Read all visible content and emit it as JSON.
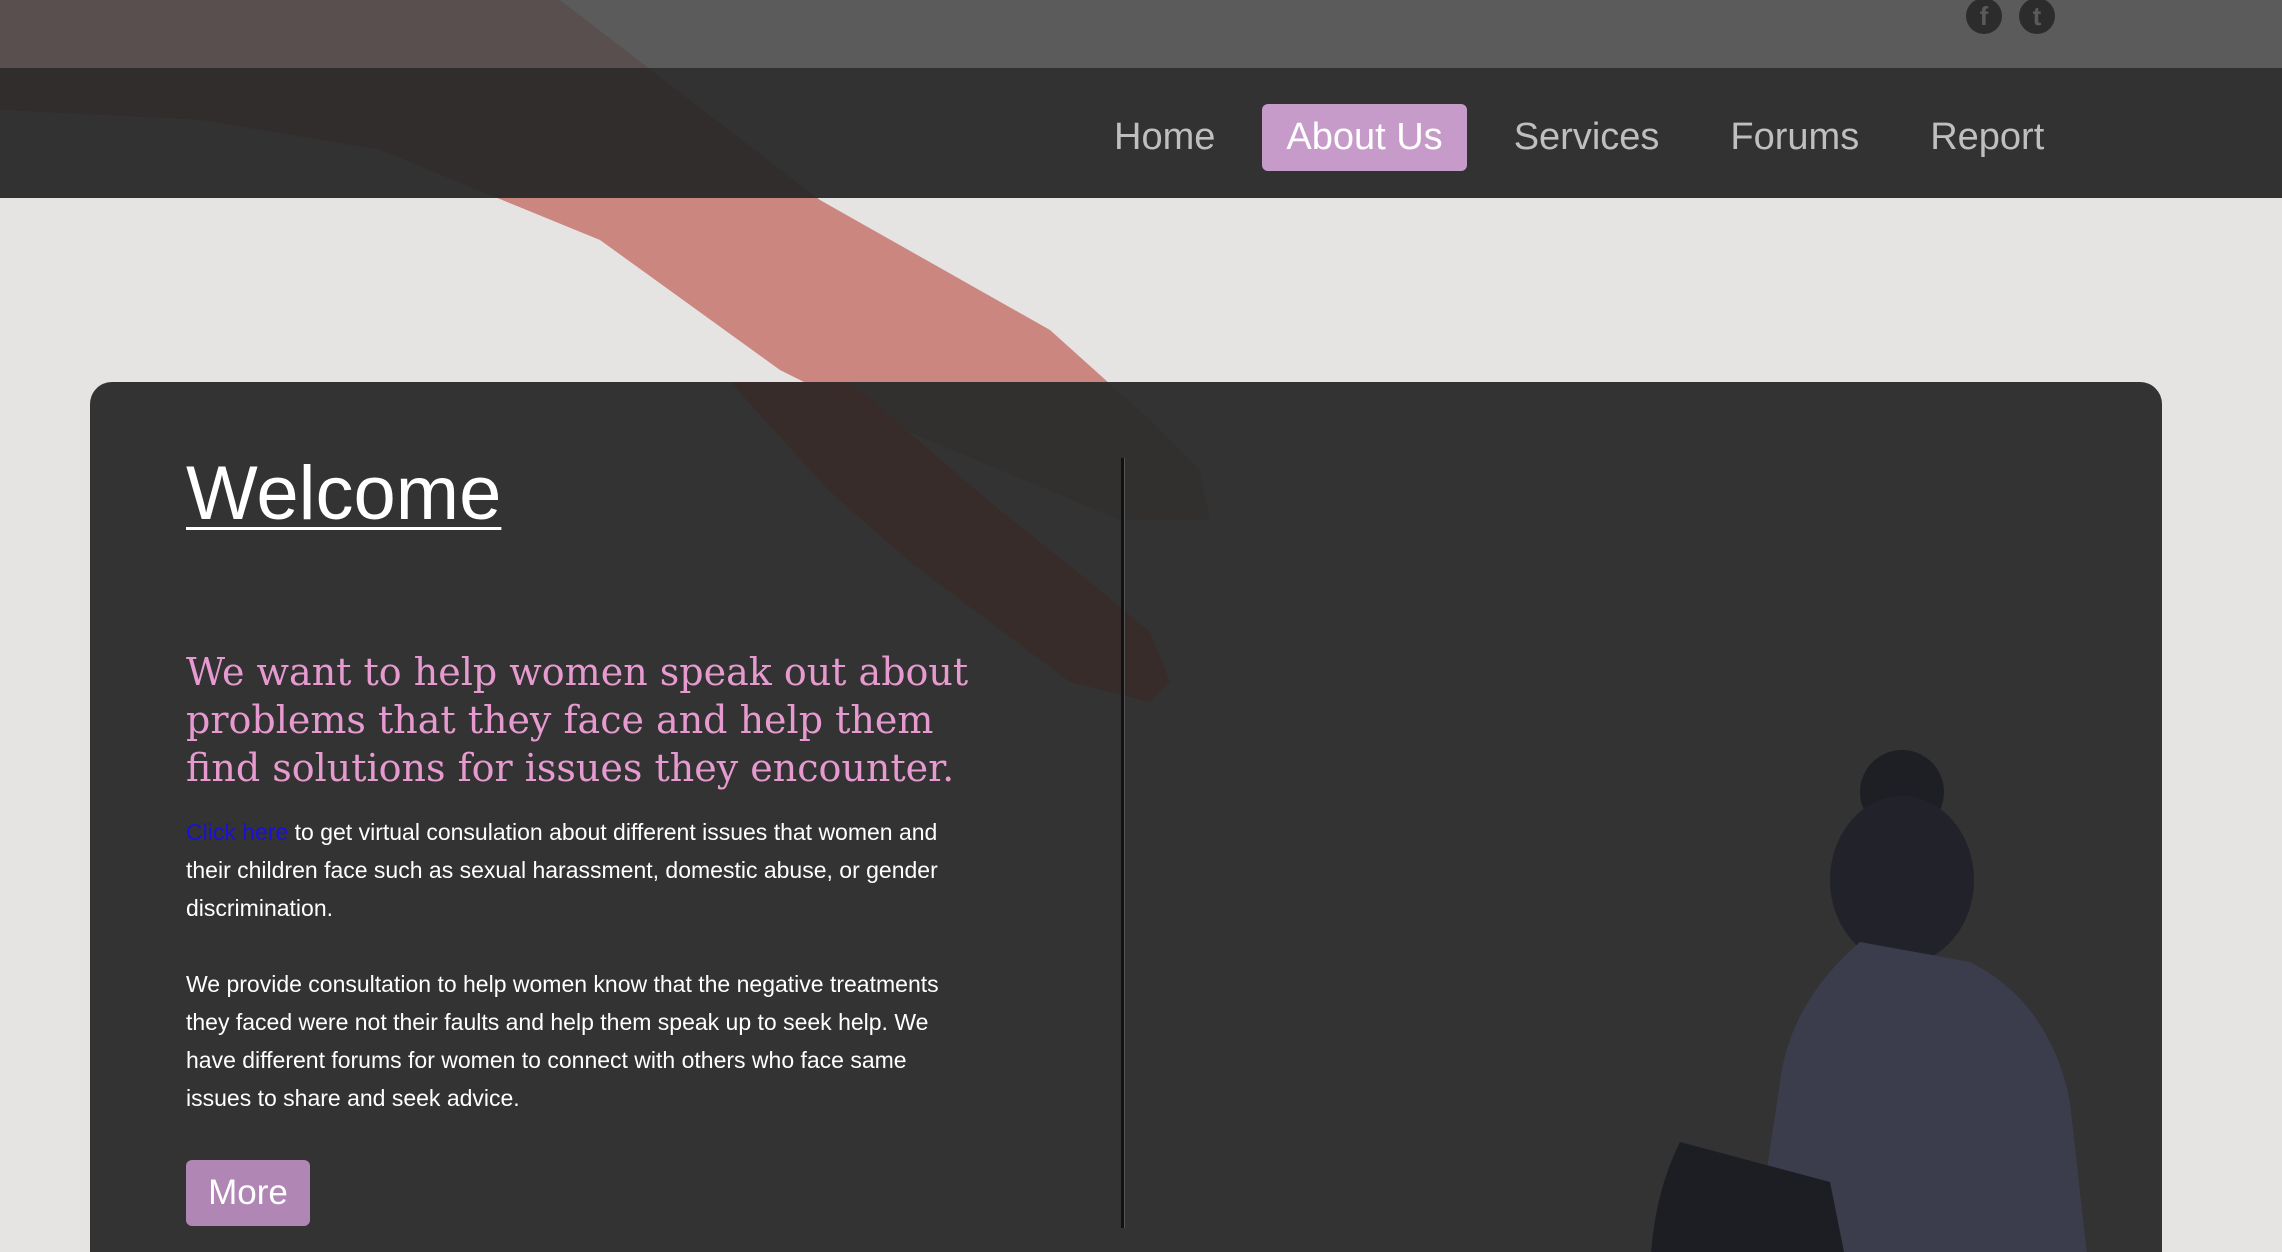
{
  "social": {
    "facebook_glyph": "f",
    "twitter_glyph": "t"
  },
  "nav": {
    "items": [
      {
        "label": "Home"
      },
      {
        "label": "About Us"
      },
      {
        "label": "Services"
      },
      {
        "label": "Forums"
      },
      {
        "label": "Report"
      }
    ],
    "active": "About Us"
  },
  "hero": {
    "title": "Welcome",
    "tagline": "We want to help women speak out about problems that they face and help them find solutions for issues they encounter.",
    "link_text": "Click here",
    "para1_rest": " to get virtual consulation about different issues that women and their children face such as sexual harassment, domestic abuse, or gender discrimination.",
    "para2": "We provide consultation to help women know that the negative treatments they faced were not their faults and help them speak up to seek help. We have different forums for women to connect with others who face same issues to share and seek advice.",
    "more_label": "More"
  },
  "colors": {
    "accent": "#c79bc9",
    "button": "#b086b4",
    "tagline": "#e79ad0",
    "link": "#1a10d8",
    "card": "#2c2c2c",
    "page_bg": "#e6e3e3"
  }
}
